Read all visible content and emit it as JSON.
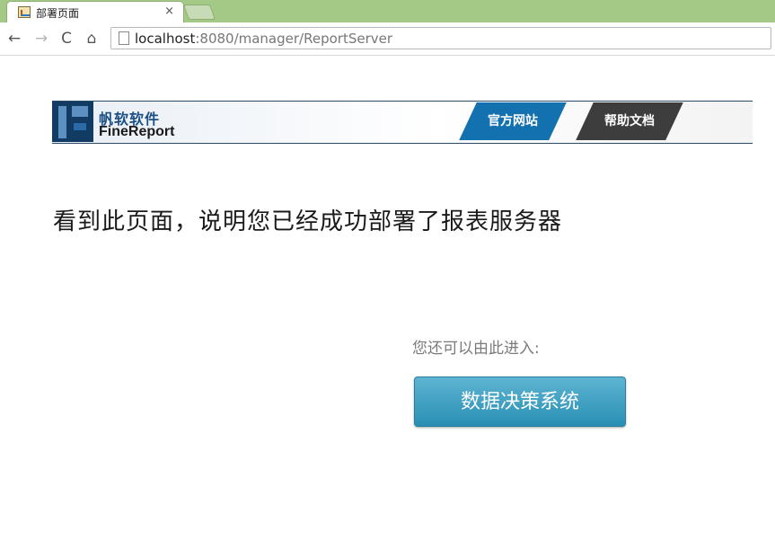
{
  "browser": {
    "tab_title": "部署页面",
    "tab_close": "×",
    "url_host": "localhost",
    "url_path": ":8080/manager/ReportServer",
    "nav": {
      "back": "←",
      "forward": "→",
      "reload": "C",
      "home": "⌂"
    }
  },
  "banner": {
    "logo_cn": "帆软软件",
    "logo_en": "FineReport",
    "official_site": "官方网站",
    "help_docs": "帮助文档"
  },
  "main": {
    "headline": "看到此页面，说明您已经成功部署了报表服务器",
    "enter_label": "您还可以由此进入:",
    "decision_button": "数据决策系统"
  },
  "colors": {
    "tabstrip": "#a4c886",
    "official_btn": "#1471b0",
    "help_btn": "#3d3d3d",
    "decision_btn": "#2a8fb4"
  }
}
